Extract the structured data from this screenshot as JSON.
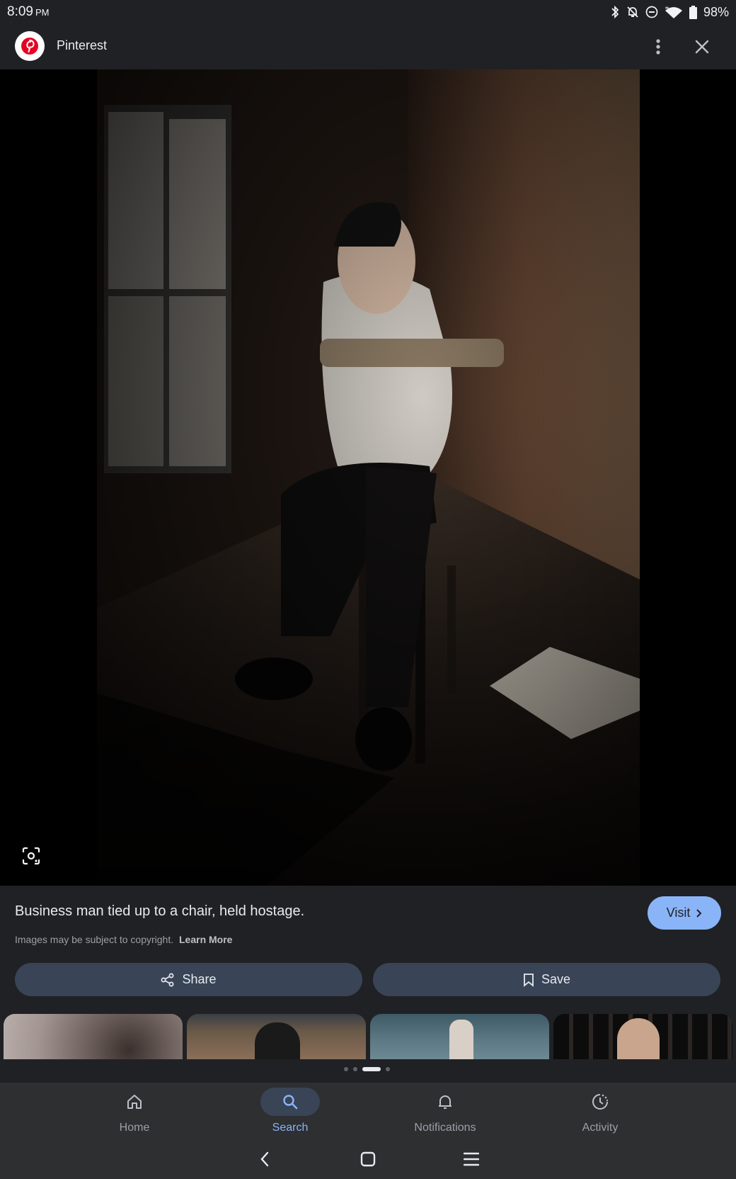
{
  "status_bar": {
    "time": "8:09",
    "ampm": "PM",
    "battery": "98%",
    "icons": [
      "bluetooth-icon",
      "notifications-off-icon",
      "do-not-disturb-icon",
      "wifi-icon",
      "battery-icon"
    ]
  },
  "header": {
    "site_name": "Pinterest",
    "logo_icon": "pinterest-logo",
    "more_icon": "more-vert-icon",
    "close_icon": "close-icon"
  },
  "image": {
    "lens_icon": "google-lens-icon"
  },
  "info": {
    "title": "Business man tied up to a chair, held hostage.",
    "copyright": "Images may be subject to copyright.",
    "learn_more": "Learn More",
    "visit_label": "Visit"
  },
  "actions": {
    "share_label": "Share",
    "save_label": "Save"
  },
  "related": {
    "count_visible": 4,
    "pager_dots": 4,
    "active_dot": 2
  },
  "bottom_nav": {
    "items": [
      {
        "label": "Home",
        "icon": "home-icon"
      },
      {
        "label": "Search",
        "icon": "search-icon"
      },
      {
        "label": "Notifications",
        "icon": "bell-icon"
      },
      {
        "label": "Activity",
        "icon": "activity-icon"
      }
    ],
    "active": "Search"
  },
  "colors": {
    "background": "#202124",
    "accent": "#8ab4f8",
    "button": "#394457",
    "pinterest_red": "#e60023"
  }
}
